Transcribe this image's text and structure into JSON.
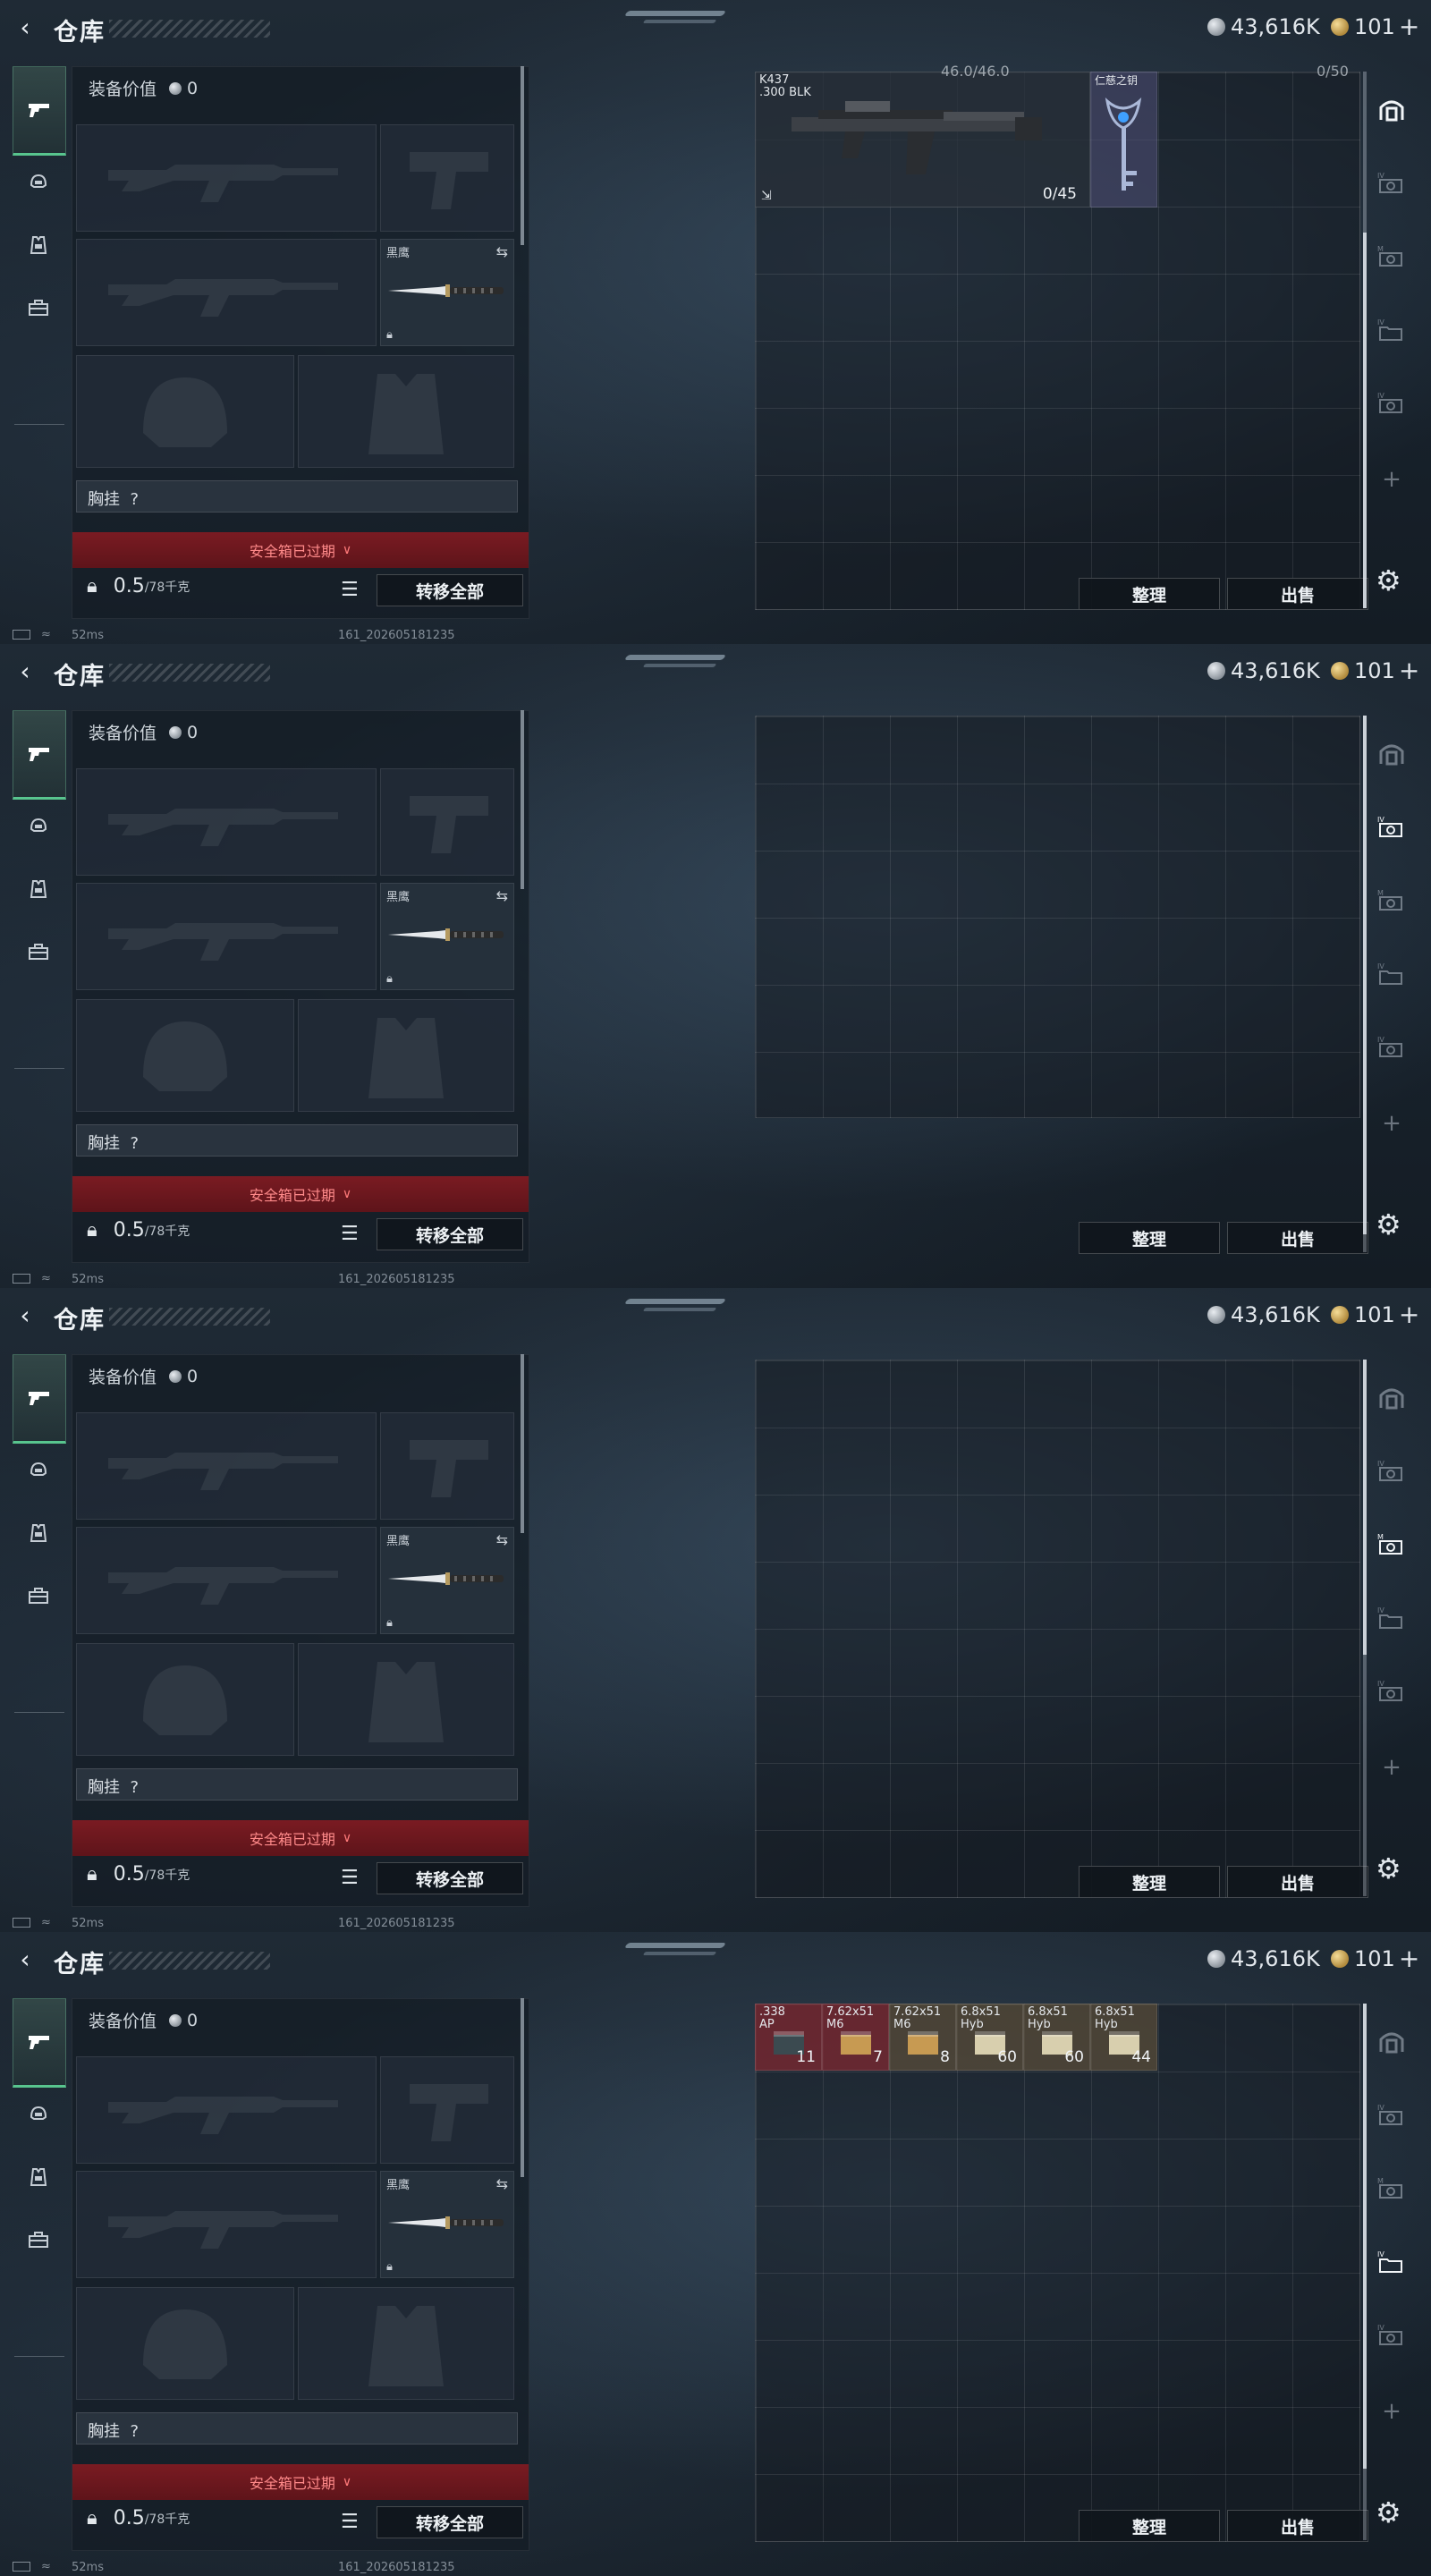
{
  "header": {
    "title": "仓库",
    "silver_amount": "43,616K",
    "gold_amount": "101"
  },
  "equipment": {
    "value_label": "装备价值",
    "value": "0",
    "melee_name": "黑鹰",
    "chest_label": "胸挂",
    "chest_help": "?",
    "safe_box_text": "安全箱已过期",
    "weight_value": "0.5",
    "weight_capacity": "/78千克",
    "transfer_all_label": "转移全部"
  },
  "stash": {
    "sort_label": "整理",
    "sell_label": "出售"
  },
  "status_bar": {
    "ping": "52ms",
    "build": "161_202605181235"
  },
  "panels": [
    {
      "active_tab": 0,
      "items": {
        "rifle": {
          "name_line1": "K437",
          "name_line2": ".300 BLK",
          "ammo": "0/45"
        },
        "key": {
          "name": "仁慈之钥"
        },
        "top_partial": "46.0/46.0",
        "top_partial_right": "0/50"
      }
    },
    {
      "active_tab": 1
    },
    {
      "active_tab": 2
    },
    {
      "active_tab": 3,
      "ammo": [
        {
          "line1": ".338",
          "line2": "AP",
          "count": "11"
        },
        {
          "line1": "7.62x51",
          "line2": "M6",
          "count": "7"
        },
        {
          "line1": "7.62x51",
          "line2": "M6",
          "count": "8"
        },
        {
          "line1": "6.8x51",
          "line2": "Hyb",
          "count": "60"
        },
        {
          "line1": "6.8x51",
          "line2": "Hyb",
          "count": "60"
        },
        {
          "line1": "6.8x51",
          "line2": "Hyb",
          "count": "44"
        }
      ]
    }
  ],
  "colors": {
    "active_green": "#58c58e",
    "safe_red": "#7a1b22",
    "safe_text": "#ff8a8a"
  }
}
